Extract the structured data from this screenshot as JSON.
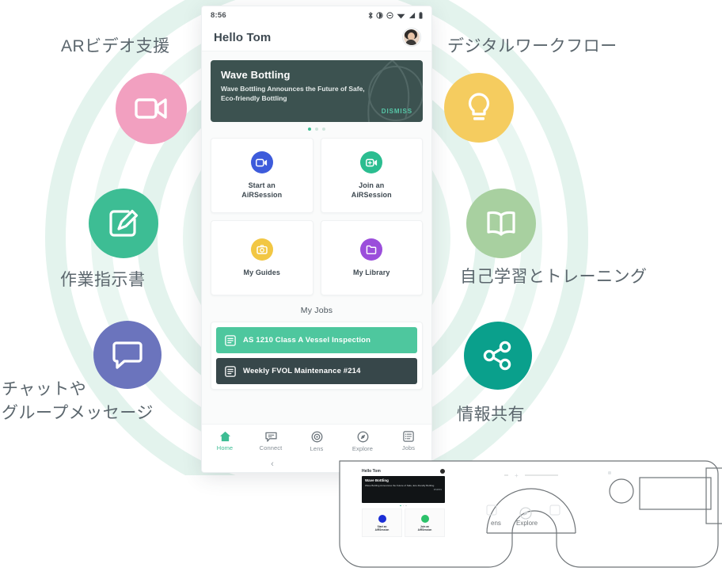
{
  "features": {
    "left": [
      {
        "label": "ARビデオ支援",
        "icon": "video-camera-icon",
        "color": "#f2a0c0"
      },
      {
        "label": "作業指示書",
        "icon": "edit-document-icon",
        "color": "#3dbd94"
      },
      {
        "label": "チャットや\nグループメッセージ",
        "icon": "chat-bubble-icon",
        "color": "#6b74bd"
      }
    ],
    "right": [
      {
        "label": "デジタルワークフロー",
        "icon": "lightbulb-icon",
        "color": "#f5cc5f"
      },
      {
        "label": "自己学習とトレーニング",
        "icon": "open-book-icon",
        "color": "#a8d0a0"
      },
      {
        "label": "情報共有",
        "icon": "share-nodes-icon",
        "color": "#0aa08c"
      }
    ]
  },
  "phone": {
    "status_bar": {
      "time": "8:56",
      "icons": [
        "bluetooth-icon",
        "brightness-icon",
        "do-not-disturb-icon",
        "wifi-icon",
        "signal-icon",
        "battery-icon"
      ]
    },
    "app_bar": {
      "greeting": "Hello Tom",
      "avatar": "user-avatar"
    },
    "banner": {
      "title": "Wave Bottling",
      "body": "Wave Bottling Announces the Future of Safe, Eco-friendly Bottling",
      "dismiss_label": "DISMISS",
      "background_color": "#3c5250",
      "accent_color": "#57c7a8",
      "dot_count": 3,
      "active_dot": 0
    },
    "tiles": [
      {
        "label": "Start an\nAiRSession",
        "icon": "start-session-icon",
        "color": "#3d5bdb"
      },
      {
        "label": "Join an\nAiRSession",
        "icon": "join-session-icon",
        "color": "#2bbd90"
      },
      {
        "label": "My Guides",
        "icon": "guides-camera-icon",
        "color": "#f2c744"
      },
      {
        "label": "My Library",
        "icon": "library-folder-icon",
        "color": "#9b4edb"
      }
    ],
    "jobs": {
      "section_title": "My Jobs",
      "items": [
        {
          "label": "AS 1210 Class A Vessel Inspection",
          "color": "#4ec79e",
          "icon": "job-list-icon"
        },
        {
          "label": "Weekly FVOL Maintenance #214",
          "color": "#37474a",
          "icon": "job-list-icon"
        }
      ]
    },
    "nav": [
      {
        "label": "Home",
        "icon": "home-icon",
        "active": true
      },
      {
        "label": "Connect",
        "icon": "connect-message-icon",
        "active": false
      },
      {
        "label": "Lens",
        "icon": "lens-target-icon",
        "active": false
      },
      {
        "label": "Explore",
        "icon": "explore-compass-icon",
        "active": false
      },
      {
        "label": "Jobs",
        "icon": "jobs-list-icon",
        "active": false
      }
    ],
    "system_nav": {
      "back": "‹",
      "home_pill": "home-pill"
    }
  },
  "glasses": {
    "name": "ar-smart-glasses-outline",
    "mini_screen": {
      "greeting": "Hello Tom",
      "banner_title": "Wave Bottling",
      "banner_body": "Wave Bottling Announces the Future of Safe, Eco-friendly Bottling",
      "dismiss_label": "DISMISS",
      "tiles": [
        {
          "label": "Start an\nAiRSession",
          "color": "#1b2ed6"
        },
        {
          "label": "Join an\nAiRSession",
          "color": "#2cc16a"
        }
      ]
    },
    "overlay_labels": [
      "Lens",
      "Explore"
    ]
  },
  "theme": {
    "ring_color": "#e3f3ed",
    "label_color": "#5b666d",
    "page_background": "#ffffff"
  }
}
